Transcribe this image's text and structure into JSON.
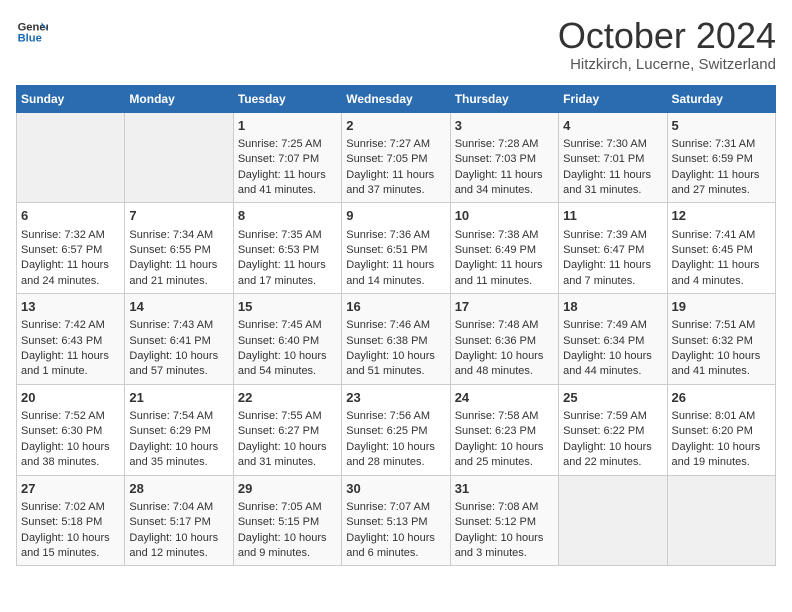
{
  "header": {
    "logo_line1": "General",
    "logo_line2": "Blue",
    "month": "October 2024",
    "location": "Hitzkirch, Lucerne, Switzerland"
  },
  "days_of_week": [
    "Sunday",
    "Monday",
    "Tuesday",
    "Wednesday",
    "Thursday",
    "Friday",
    "Saturday"
  ],
  "weeks": [
    [
      {
        "num": "",
        "sunrise": "",
        "sunset": "",
        "daylight": ""
      },
      {
        "num": "",
        "sunrise": "",
        "sunset": "",
        "daylight": ""
      },
      {
        "num": "1",
        "sunrise": "Sunrise: 7:25 AM",
        "sunset": "Sunset: 7:07 PM",
        "daylight": "Daylight: 11 hours and 41 minutes."
      },
      {
        "num": "2",
        "sunrise": "Sunrise: 7:27 AM",
        "sunset": "Sunset: 7:05 PM",
        "daylight": "Daylight: 11 hours and 37 minutes."
      },
      {
        "num": "3",
        "sunrise": "Sunrise: 7:28 AM",
        "sunset": "Sunset: 7:03 PM",
        "daylight": "Daylight: 11 hours and 34 minutes."
      },
      {
        "num": "4",
        "sunrise": "Sunrise: 7:30 AM",
        "sunset": "Sunset: 7:01 PM",
        "daylight": "Daylight: 11 hours and 31 minutes."
      },
      {
        "num": "5",
        "sunrise": "Sunrise: 7:31 AM",
        "sunset": "Sunset: 6:59 PM",
        "daylight": "Daylight: 11 hours and 27 minutes."
      }
    ],
    [
      {
        "num": "6",
        "sunrise": "Sunrise: 7:32 AM",
        "sunset": "Sunset: 6:57 PM",
        "daylight": "Daylight: 11 hours and 24 minutes."
      },
      {
        "num": "7",
        "sunrise": "Sunrise: 7:34 AM",
        "sunset": "Sunset: 6:55 PM",
        "daylight": "Daylight: 11 hours and 21 minutes."
      },
      {
        "num": "8",
        "sunrise": "Sunrise: 7:35 AM",
        "sunset": "Sunset: 6:53 PM",
        "daylight": "Daylight: 11 hours and 17 minutes."
      },
      {
        "num": "9",
        "sunrise": "Sunrise: 7:36 AM",
        "sunset": "Sunset: 6:51 PM",
        "daylight": "Daylight: 11 hours and 14 minutes."
      },
      {
        "num": "10",
        "sunrise": "Sunrise: 7:38 AM",
        "sunset": "Sunset: 6:49 PM",
        "daylight": "Daylight: 11 hours and 11 minutes."
      },
      {
        "num": "11",
        "sunrise": "Sunrise: 7:39 AM",
        "sunset": "Sunset: 6:47 PM",
        "daylight": "Daylight: 11 hours and 7 minutes."
      },
      {
        "num": "12",
        "sunrise": "Sunrise: 7:41 AM",
        "sunset": "Sunset: 6:45 PM",
        "daylight": "Daylight: 11 hours and 4 minutes."
      }
    ],
    [
      {
        "num": "13",
        "sunrise": "Sunrise: 7:42 AM",
        "sunset": "Sunset: 6:43 PM",
        "daylight": "Daylight: 11 hours and 1 minute."
      },
      {
        "num": "14",
        "sunrise": "Sunrise: 7:43 AM",
        "sunset": "Sunset: 6:41 PM",
        "daylight": "Daylight: 10 hours and 57 minutes."
      },
      {
        "num": "15",
        "sunrise": "Sunrise: 7:45 AM",
        "sunset": "Sunset: 6:40 PM",
        "daylight": "Daylight: 10 hours and 54 minutes."
      },
      {
        "num": "16",
        "sunrise": "Sunrise: 7:46 AM",
        "sunset": "Sunset: 6:38 PM",
        "daylight": "Daylight: 10 hours and 51 minutes."
      },
      {
        "num": "17",
        "sunrise": "Sunrise: 7:48 AM",
        "sunset": "Sunset: 6:36 PM",
        "daylight": "Daylight: 10 hours and 48 minutes."
      },
      {
        "num": "18",
        "sunrise": "Sunrise: 7:49 AM",
        "sunset": "Sunset: 6:34 PM",
        "daylight": "Daylight: 10 hours and 44 minutes."
      },
      {
        "num": "19",
        "sunrise": "Sunrise: 7:51 AM",
        "sunset": "Sunset: 6:32 PM",
        "daylight": "Daylight: 10 hours and 41 minutes."
      }
    ],
    [
      {
        "num": "20",
        "sunrise": "Sunrise: 7:52 AM",
        "sunset": "Sunset: 6:30 PM",
        "daylight": "Daylight: 10 hours and 38 minutes."
      },
      {
        "num": "21",
        "sunrise": "Sunrise: 7:54 AM",
        "sunset": "Sunset: 6:29 PM",
        "daylight": "Daylight: 10 hours and 35 minutes."
      },
      {
        "num": "22",
        "sunrise": "Sunrise: 7:55 AM",
        "sunset": "Sunset: 6:27 PM",
        "daylight": "Daylight: 10 hours and 31 minutes."
      },
      {
        "num": "23",
        "sunrise": "Sunrise: 7:56 AM",
        "sunset": "Sunset: 6:25 PM",
        "daylight": "Daylight: 10 hours and 28 minutes."
      },
      {
        "num": "24",
        "sunrise": "Sunrise: 7:58 AM",
        "sunset": "Sunset: 6:23 PM",
        "daylight": "Daylight: 10 hours and 25 minutes."
      },
      {
        "num": "25",
        "sunrise": "Sunrise: 7:59 AM",
        "sunset": "Sunset: 6:22 PM",
        "daylight": "Daylight: 10 hours and 22 minutes."
      },
      {
        "num": "26",
        "sunrise": "Sunrise: 8:01 AM",
        "sunset": "Sunset: 6:20 PM",
        "daylight": "Daylight: 10 hours and 19 minutes."
      }
    ],
    [
      {
        "num": "27",
        "sunrise": "Sunrise: 7:02 AM",
        "sunset": "Sunset: 5:18 PM",
        "daylight": "Daylight: 10 hours and 15 minutes."
      },
      {
        "num": "28",
        "sunrise": "Sunrise: 7:04 AM",
        "sunset": "Sunset: 5:17 PM",
        "daylight": "Daylight: 10 hours and 12 minutes."
      },
      {
        "num": "29",
        "sunrise": "Sunrise: 7:05 AM",
        "sunset": "Sunset: 5:15 PM",
        "daylight": "Daylight: 10 hours and 9 minutes."
      },
      {
        "num": "30",
        "sunrise": "Sunrise: 7:07 AM",
        "sunset": "Sunset: 5:13 PM",
        "daylight": "Daylight: 10 hours and 6 minutes."
      },
      {
        "num": "31",
        "sunrise": "Sunrise: 7:08 AM",
        "sunset": "Sunset: 5:12 PM",
        "daylight": "Daylight: 10 hours and 3 minutes."
      },
      {
        "num": "",
        "sunrise": "",
        "sunset": "",
        "daylight": ""
      },
      {
        "num": "",
        "sunrise": "",
        "sunset": "",
        "daylight": ""
      }
    ]
  ]
}
